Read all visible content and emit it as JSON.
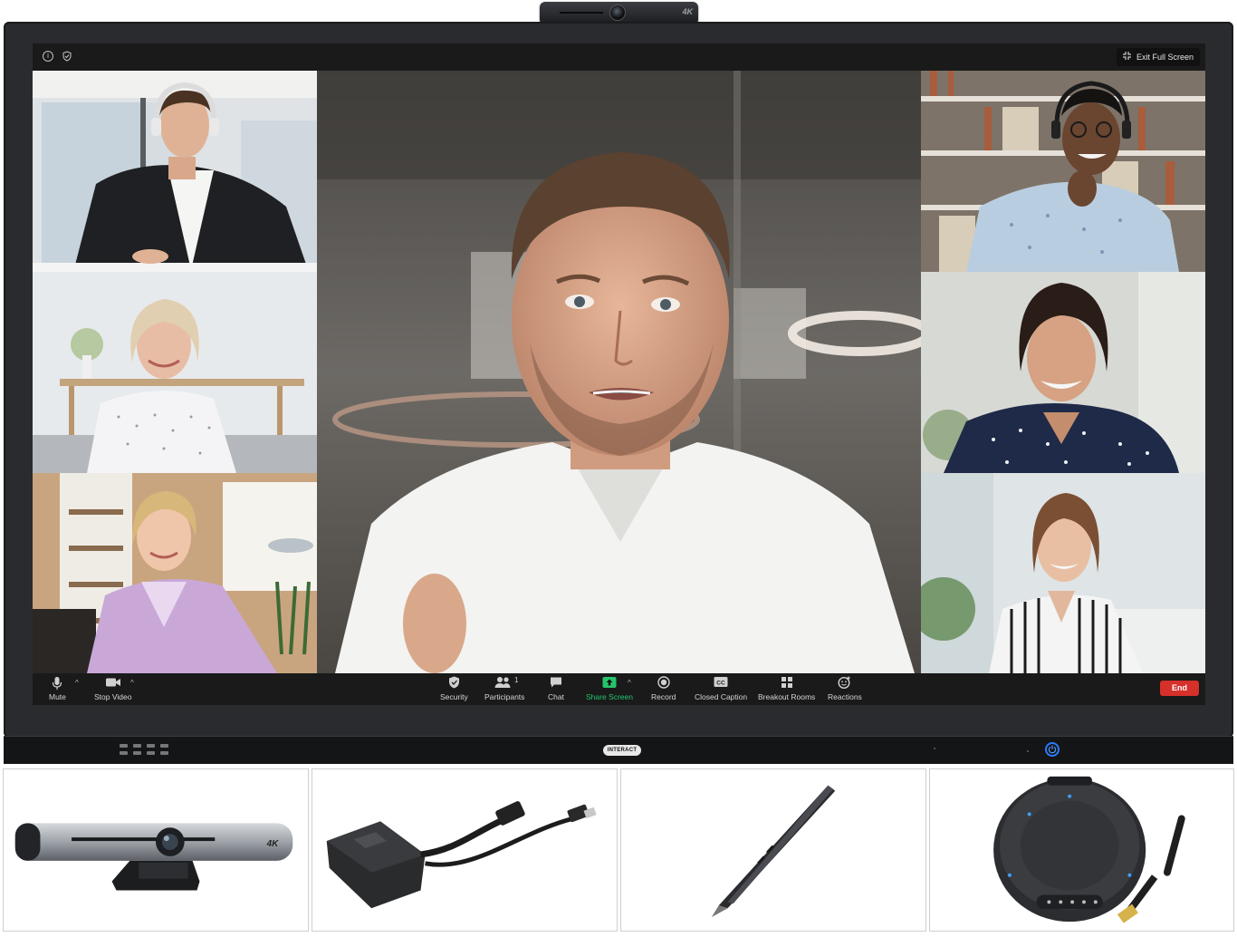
{
  "camera": {
    "badge": "4K"
  },
  "screen": {
    "exit_fullscreen_label": "Exit Full Screen"
  },
  "toolbar": {
    "left": [
      {
        "id": "mute",
        "label": "Mute",
        "icon": "microphone-icon"
      },
      {
        "id": "stop-video",
        "label": "Stop Video",
        "icon": "video-camera-icon"
      }
    ],
    "center": [
      {
        "id": "security",
        "label": "Security",
        "icon": "shield-icon"
      },
      {
        "id": "participants",
        "label": "Participants",
        "icon": "participants-icon",
        "count": "1"
      },
      {
        "id": "chat",
        "label": "Chat",
        "icon": "chat-bubble-icon"
      },
      {
        "id": "share-screen",
        "label": "Share Screen",
        "icon": "share-arrow-icon"
      },
      {
        "id": "record",
        "label": "Record",
        "icon": "record-icon"
      },
      {
        "id": "closed-caption",
        "label": "Closed Caption",
        "icon": "cc-icon"
      },
      {
        "id": "breakout-rooms",
        "label": "Breakout Rooms",
        "icon": "grid-icon"
      },
      {
        "id": "reactions",
        "label": "Reactions",
        "icon": "smiley-plus-icon"
      }
    ],
    "end_label": "End"
  },
  "colors": {
    "share_green": "#25c46b",
    "end_red": "#d6302a",
    "power_blue": "#2a7bff"
  },
  "device": {
    "brand": "INTERACT"
  },
  "accessories": {
    "camera_badge": "4K"
  }
}
